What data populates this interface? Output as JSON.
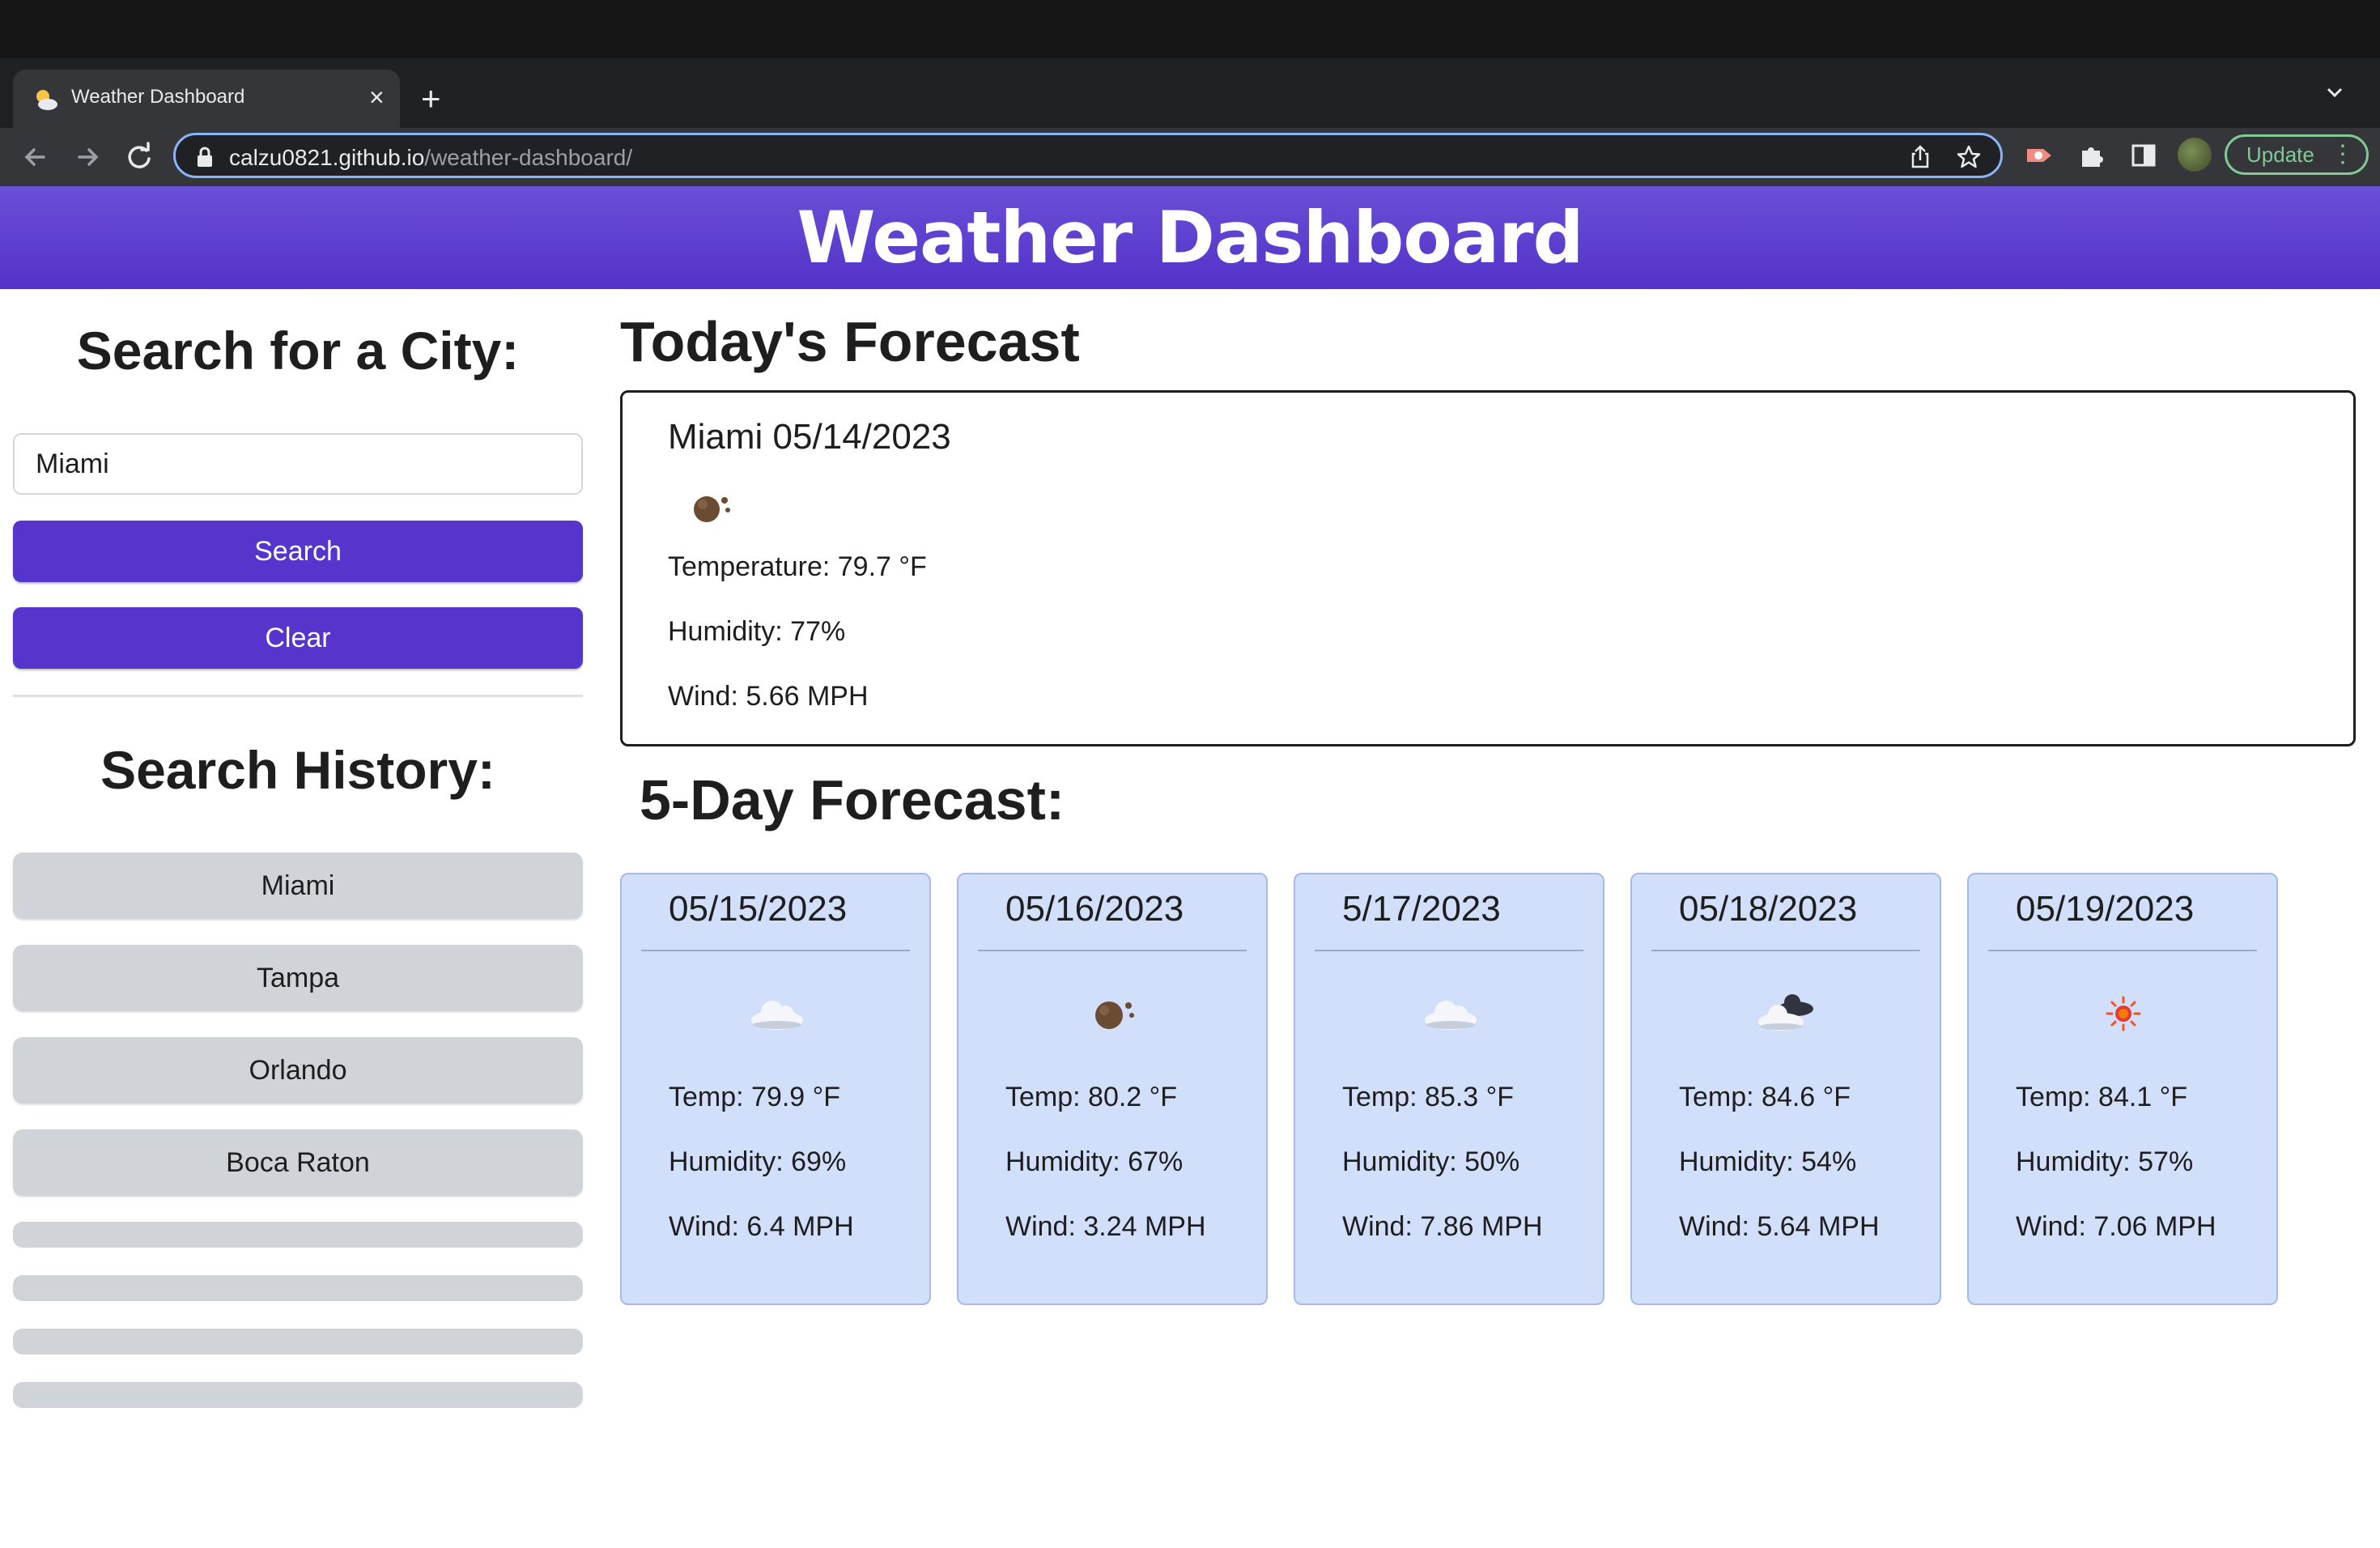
{
  "browser": {
    "tab_title": "Weather Dashboard",
    "url_host": "calzu0821.github.io",
    "url_path": "/weather-dashboard/",
    "update_label": "Update"
  },
  "header": {
    "title": "Weather Dashboard"
  },
  "sidebar": {
    "search_heading": "Search for a City:",
    "search_value": "Miami",
    "search_button": "Search",
    "clear_button": "Clear",
    "history_heading": "Search History:",
    "history": [
      "Miami",
      "Tampa",
      "Orlando",
      "Boca Raton"
    ]
  },
  "today": {
    "heading": "Today's Forecast",
    "title": "Miami 05/14/2023",
    "icon": "broken-clouds-night-icon",
    "temperature": "Temperature: 79.7 °F",
    "humidity": "Humidity: 77%",
    "wind": "Wind: 5.66 MPH"
  },
  "forecast": {
    "heading": "5-Day Forecast:",
    "days": [
      {
        "date": "05/15/2023",
        "icon": "cloud-icon",
        "temp": "Temp: 79.9 °F",
        "humidity": "Humidity: 69%",
        "wind": "Wind: 6.4 MPH"
      },
      {
        "date": "05/16/2023",
        "icon": "broken-clouds-night-icon",
        "temp": "Temp: 80.2 °F",
        "humidity": "Humidity: 67%",
        "wind": "Wind: 3.24 MPH"
      },
      {
        "date": "5/17/2023",
        "icon": "cloud-icon",
        "temp": "Temp: 85.3 °F",
        "humidity": "Humidity: 50%",
        "wind": "Wind: 7.86 MPH"
      },
      {
        "date": "05/18/2023",
        "icon": "dark-clouds-icon",
        "temp": "Temp: 84.6 °F",
        "humidity": "Humidity: 54%",
        "wind": "Wind: 5.64 MPH"
      },
      {
        "date": "05/19/2023",
        "icon": "sun-icon",
        "temp": "Temp: 84.1 °F",
        "humidity": "Humidity: 57%",
        "wind": "Wind: 7.06 MPH"
      }
    ]
  },
  "colors": {
    "header": "#5a3fd0",
    "primary_button": "#5535cc",
    "history_button": "#d0d3d8",
    "forecast_card": "#d1dffa"
  }
}
